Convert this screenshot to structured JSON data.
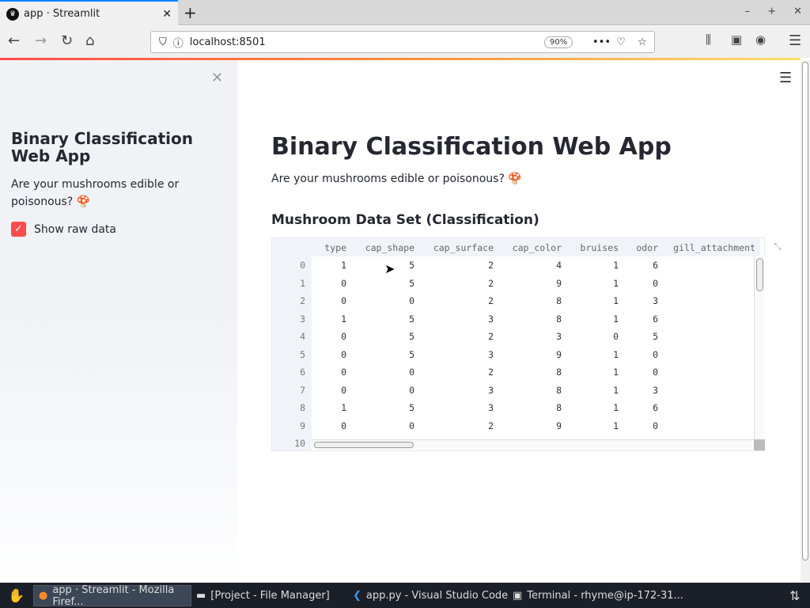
{
  "browser": {
    "tab_title": "app · Streamlit",
    "url": "localhost:8501",
    "zoom": "90%"
  },
  "sidebar": {
    "title": "Binary Classification Web App",
    "subtitle": "Are your mushrooms edible or poisonous? 🍄",
    "checkbox_label": "Show raw data",
    "checkbox_checked": true
  },
  "main": {
    "title": "Binary Classification Web App",
    "subtitle": "Are your mushrooms edible or poisonous? 🍄",
    "section": "Mushroom Data Set (Classification)"
  },
  "table": {
    "columns": [
      "type",
      "cap_shape",
      "cap_surface",
      "cap_color",
      "bruises",
      "odor",
      "gill_attachment"
    ],
    "rows": [
      [
        "0",
        1,
        5,
        2,
        4,
        1,
        6,
        ""
      ],
      [
        "1",
        0,
        5,
        2,
        9,
        1,
        0,
        ""
      ],
      [
        "2",
        0,
        0,
        2,
        8,
        1,
        3,
        ""
      ],
      [
        "3",
        1,
        5,
        3,
        8,
        1,
        6,
        ""
      ],
      [
        "4",
        0,
        5,
        2,
        3,
        0,
        5,
        ""
      ],
      [
        "5",
        0,
        5,
        3,
        9,
        1,
        0,
        ""
      ],
      [
        "6",
        0,
        0,
        2,
        8,
        1,
        0,
        ""
      ],
      [
        "7",
        0,
        0,
        3,
        8,
        1,
        3,
        ""
      ],
      [
        "8",
        1,
        5,
        3,
        8,
        1,
        6,
        ""
      ],
      [
        "9",
        0,
        0,
        2,
        9,
        1,
        0,
        ""
      ],
      [
        "10",
        "",
        "",
        "",
        "",
        "",
        "",
        ""
      ]
    ]
  },
  "taskbar": {
    "items": [
      "app · Streamlit - Mozilla Firef...",
      "[Project - File Manager]",
      "app.py - Visual Studio Code",
      "Terminal - rhyme@ip-172-31..."
    ]
  },
  "colors": {
    "accent": "#ff4b4b",
    "sidebar_bg": "#f0f2f6"
  }
}
